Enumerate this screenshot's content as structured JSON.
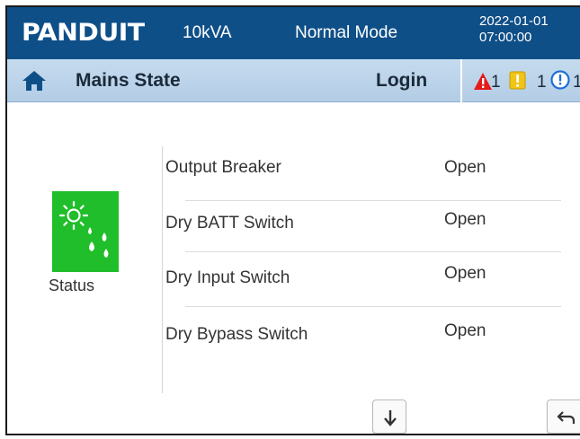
{
  "header": {
    "brand": "PANDUIT",
    "rating": "10kVA",
    "mode": "Normal Mode",
    "date": "2022-01-01",
    "time": "07:00:00"
  },
  "subheader": {
    "home_icon": "home-icon",
    "title": "Mains State",
    "login_label": "Login",
    "alarms": [
      {
        "icon": "warning-triangle-icon",
        "color": "#e41b1b",
        "count": "1"
      },
      {
        "icon": "caution-square-icon",
        "color": "#f0c419",
        "count": "1"
      },
      {
        "icon": "info-circle-icon",
        "color": "#1f6fd6",
        "count": "1"
      }
    ]
  },
  "status": {
    "label": "Status",
    "icon": "sun-rain-icon",
    "color": "#1fbe2a"
  },
  "rows": [
    {
      "name": "Output Breaker",
      "value": "Open"
    },
    {
      "name": "Dry BATT Switch",
      "value": "Open"
    },
    {
      "name": "Dry Input Switch",
      "value": "Open"
    },
    {
      "name": "Dry Bypass Switch",
      "value": "Open"
    }
  ],
  "buttons": {
    "down": "down-arrow-icon",
    "back": "back-arrow-icon"
  }
}
